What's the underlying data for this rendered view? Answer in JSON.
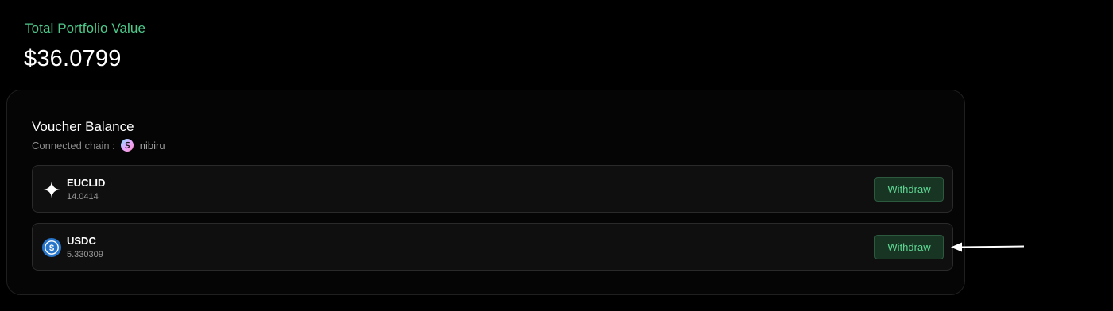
{
  "portfolio": {
    "label": "Total Portfolio Value",
    "value": "$36.0799"
  },
  "voucher": {
    "title": "Voucher Balance",
    "chain_label": "Connected chain :",
    "chain_name": "nibiru",
    "chain_icon": "nibiru-logo-icon",
    "tokens": [
      {
        "symbol": "EUCLID",
        "amount": "14.0414",
        "icon": "euclid-sparkle-icon",
        "withdraw_label": "Withdraw"
      },
      {
        "symbol": "USDC",
        "amount": "5.330309",
        "icon": "usdc-coin-icon",
        "withdraw_label": "Withdraw"
      }
    ]
  },
  "colors": {
    "background": "#000000",
    "accent_green": "#4ec98b",
    "button_bg": "#183423",
    "button_text": "#5fd894",
    "usdc_blue": "#2775ca"
  },
  "annotation": {
    "icon": "arrow-left-icon"
  }
}
